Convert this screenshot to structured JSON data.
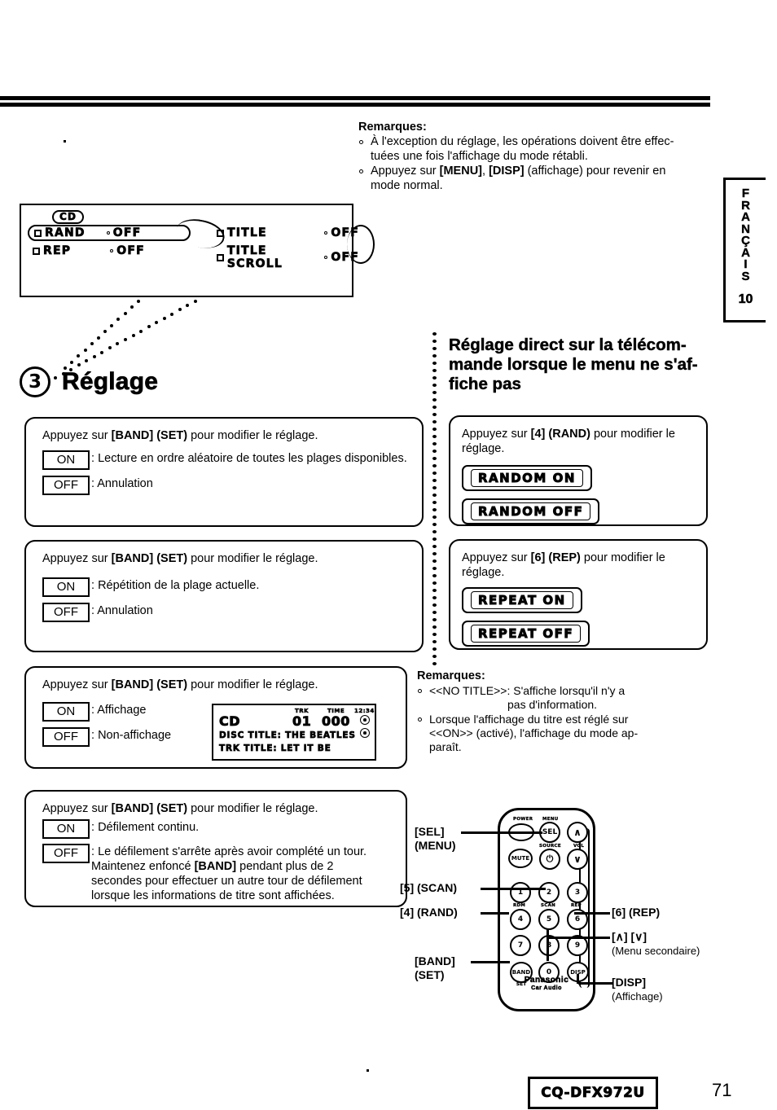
{
  "page": {
    "number": "71",
    "model": "CQ-DFX972U",
    "language_tab": "FRANÇAIS",
    "chapter_number": "10"
  },
  "remarks_top": {
    "title": "Remarques:",
    "items": [
      "À l'exception du réglage, les opérations doivent être effectuées une fois l'affichage du mode rétabli.",
      "Appuyez sur [MENU], [DISP] (affichage) pour revenir en mode normal."
    ],
    "item1_line1": "À l'exception du réglage, les opérations doivent être effec-",
    "item1_line2": "tuées une fois l'affichage du mode rétabli.",
    "item2_pre": "Appuyez sur ",
    "item2_b1": "[MENU]",
    "item2_mid": ", ",
    "item2_b2": "[DISP]",
    "item2_post": " (affichage) pour revenir en",
    "item2_line2": "mode normal."
  },
  "lcd_menu": {
    "badge": "CD",
    "rows": [
      {
        "label": "RAND",
        "value": "OFF"
      },
      {
        "label": "REP",
        "value": "OFF"
      },
      {
        "label": "TITLE",
        "value": "OFF"
      },
      {
        "label": "TITLE SCROLL",
        "value": "OFF"
      }
    ]
  },
  "section": {
    "number": "3",
    "title": "Réglage"
  },
  "left_boxes": [
    {
      "name": "random",
      "press": {
        "pre": "Appuyez sur ",
        "b1": "[BAND] (SET)",
        "post": " pour modifier le réglage."
      },
      "options": [
        {
          "key": "ON",
          "desc": "Lecture en ordre aléatoire de toutes les plages disponibles."
        },
        {
          "key": "OFF",
          "desc": "Annulation"
        }
      ]
    },
    {
      "name": "repeat",
      "press": {
        "pre": "Appuyez sur ",
        "b1": "[BAND] (SET)",
        "post": " pour modifier le réglage."
      },
      "options": [
        {
          "key": "ON",
          "desc": "Répétition de la plage actuelle."
        },
        {
          "key": "OFF",
          "desc": "Annulation"
        }
      ]
    },
    {
      "name": "title",
      "press": {
        "pre": "Appuyez sur ",
        "b1": "[BAND] (SET)",
        "post": " pour modifier le réglage."
      },
      "options": [
        {
          "key": "ON",
          "desc": "Affichage"
        },
        {
          "key": "OFF",
          "desc": "Non-affichage"
        }
      ]
    },
    {
      "name": "title-scroll",
      "press": {
        "pre": "Appuyez sur ",
        "b1": "[BAND] (SET)",
        "post": " pour modifier le réglage."
      },
      "options": [
        {
          "key": "ON",
          "desc": "Défilement continu."
        },
        {
          "key": "OFF",
          "desc": "Le défilement s'arrête après avoir complété un tour. Maintenez enfoncé [BAND] pendant plus de 2 secondes pour effectuer un autre tour de défilement lorsque les informations de titre sont affichées."
        }
      ]
    }
  ],
  "scroll_off_text": {
    "seg1": "Le défilement s'arrête après avoir complété un tour. Maintenez enfoncé ",
    "bold": "[BAND]",
    "seg2": " pendant plus de 2 secondes pour effectuer un autre tour de défilement lorsque les informations de titre sont affichées."
  },
  "right_heading": {
    "line1": "Réglage direct sur la télécom-",
    "line2": "mande lorsque le menu ne s'af-",
    "line3": "fiche pas"
  },
  "right_boxes": [
    {
      "name": "random-direct",
      "press_pre": "Appuyez sur ",
      "press_b": "[4] (RAND)",
      "press_post": " pour modifier le",
      "press_line2": "réglage.",
      "display_on": "RANDOM ON",
      "display_off": "RANDOM OFF"
    },
    {
      "name": "repeat-direct",
      "press_pre": "Appuyez sur ",
      "press_b": "[6] (REP)",
      "press_post": " pour modifier le",
      "press_line2": "réglage.",
      "display_on": "REPEAT ON",
      "display_off": "REPEAT OFF"
    }
  ],
  "lcd_title_display": {
    "source": "CD",
    "trk_label": "TRK",
    "trk_value": "01",
    "time_label": "TIME",
    "time_value": "000",
    "clock": "12:34",
    "disc_title_line": "DISC TITLE: THE BEATLES",
    "trk_title_line": "TRK TITLE: LET IT BE"
  },
  "remarks_mid": {
    "title": "Remarques:",
    "item1_a": "<<NO TITLE>>: S'affiche lorsqu'il n'y a",
    "item1_b": "pas d'information.",
    "item2_l1": "Lorsque l'affichage du titre est réglé sur",
    "item2_l2": "<<ON>> (activé), l'affichage du mode ap-",
    "item2_l3": "paraît."
  },
  "remote": {
    "brand": "Panasonic",
    "brand_sub": "Car Audio",
    "buttons": [
      {
        "id": "power",
        "label": "POWER",
        "face": ""
      },
      {
        "id": "sel",
        "label": "MENU",
        "face": "SEL"
      },
      {
        "id": "vol-up",
        "label": "VOL",
        "face": "∧"
      },
      {
        "id": "mute",
        "label": "",
        "face": "MUTE"
      },
      {
        "id": "source",
        "label": "SOURCE",
        "face": "⏻"
      },
      {
        "id": "vol-down",
        "label": "",
        "face": "∨"
      },
      {
        "id": "num1",
        "label": "RDM",
        "face": "1"
      },
      {
        "id": "num2",
        "label": "SCAN",
        "face": "2"
      },
      {
        "id": "num3",
        "label": "REP",
        "face": "3"
      },
      {
        "id": "num4",
        "label": "",
        "face": "4"
      },
      {
        "id": "num5",
        "label": "",
        "face": "5"
      },
      {
        "id": "num6",
        "label": "",
        "face": "6"
      },
      {
        "id": "num7",
        "label": "",
        "face": "7"
      },
      {
        "id": "num8",
        "label": "",
        "face": "8"
      },
      {
        "id": "num9",
        "label": "",
        "face": "9"
      },
      {
        "id": "band",
        "label": "SET",
        "face": "BAND"
      },
      {
        "id": "num0",
        "label": "",
        "face": "0"
      },
      {
        "id": "disp",
        "label": "",
        "face": "DISP"
      }
    ],
    "callouts": {
      "sel_l1": "[SEL]",
      "sel_l2": "(MENU)",
      "scan": "[5] (SCAN)",
      "rand": "[4] (RAND)",
      "band_l1": "[BAND]",
      "band_l2": "(SET)",
      "rep": "[6] (REP)",
      "updown_l1": "[∧] [∨]",
      "updown_l2": "(Menu secondaire)",
      "disp_l1": "[DISP]",
      "disp_l2": "(Affichage)"
    }
  }
}
